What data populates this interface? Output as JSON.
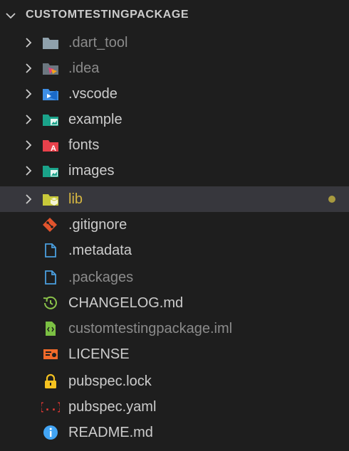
{
  "explorer": {
    "title": "CUSTOMTESTINGPACKAGE",
    "items": [
      {
        "label": ".dart_tool",
        "kind": "folder",
        "icon": "folder-icon",
        "dim": true
      },
      {
        "label": ".idea",
        "kind": "folder",
        "icon": "idea-folder-icon",
        "dim": true
      },
      {
        "label": ".vscode",
        "kind": "folder",
        "icon": "vscode-folder-icon",
        "dim": false
      },
      {
        "label": "example",
        "kind": "folder",
        "icon": "example-folder-icon",
        "dim": false
      },
      {
        "label": "fonts",
        "kind": "folder",
        "icon": "fonts-folder-icon",
        "dim": false
      },
      {
        "label": "images",
        "kind": "folder",
        "icon": "images-folder-icon",
        "dim": false
      },
      {
        "label": "lib",
        "kind": "folder",
        "icon": "lib-folder-icon",
        "selected": true,
        "modified": true
      },
      {
        "label": ".gitignore",
        "kind": "file",
        "icon": "git-icon",
        "dim": false
      },
      {
        "label": ".metadata",
        "kind": "file",
        "icon": "file-icon",
        "dim": false
      },
      {
        "label": ".packages",
        "kind": "file",
        "icon": "file-icon",
        "dim": true
      },
      {
        "label": "CHANGELOG.md",
        "kind": "file",
        "icon": "changelog-icon",
        "dim": false
      },
      {
        "label": "customtestingpackage.iml",
        "kind": "file",
        "icon": "iml-file-icon",
        "dim": true
      },
      {
        "label": "LICENSE",
        "kind": "file",
        "icon": "license-icon",
        "dim": false
      },
      {
        "label": "pubspec.lock",
        "kind": "file",
        "icon": "lock-icon",
        "dim": false
      },
      {
        "label": "pubspec.yaml",
        "kind": "file",
        "icon": "yaml-icon",
        "dim": false
      },
      {
        "label": "README.md",
        "kind": "file",
        "icon": "info-icon",
        "dim": false
      }
    ]
  },
  "colors": {
    "background": "#1e1e1e",
    "selected_row": "#37373d",
    "text": "#cccccc",
    "dim_text": "#8b8b8b",
    "modified_text": "#d5b642",
    "modified_dot": "#a89a3f"
  }
}
